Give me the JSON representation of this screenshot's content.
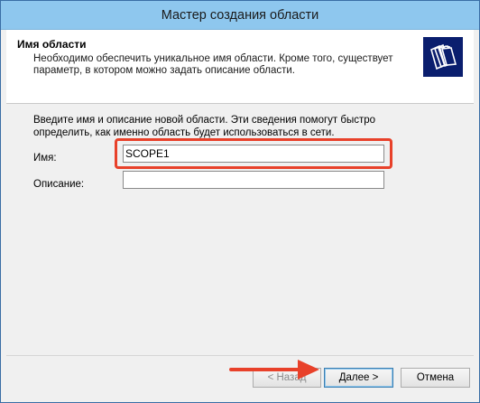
{
  "window": {
    "title": "Мастер создания области"
  },
  "header": {
    "title": "Имя области",
    "description": "Необходимо обеспечить уникальное имя области. Кроме того, существует параметр, в котором можно задать описание области."
  },
  "content": {
    "intro": "Введите имя и описание новой области. Эти сведения помогут быстро определить, как именно область будет использоваться в сети.",
    "name_label": "Имя:",
    "name_value": "SCOPE1",
    "description_label": "Описание:",
    "description_value": ""
  },
  "buttons": {
    "back": "< Назад",
    "next": "Далее >",
    "cancel": "Отмена"
  },
  "colors": {
    "titlebar": "#8ec7ee",
    "highlight": "#e8412a",
    "arrow": "#e8412a"
  },
  "icons": {
    "header_icon": "folder-stack-icon",
    "annotation": "red-arrow-icon"
  }
}
